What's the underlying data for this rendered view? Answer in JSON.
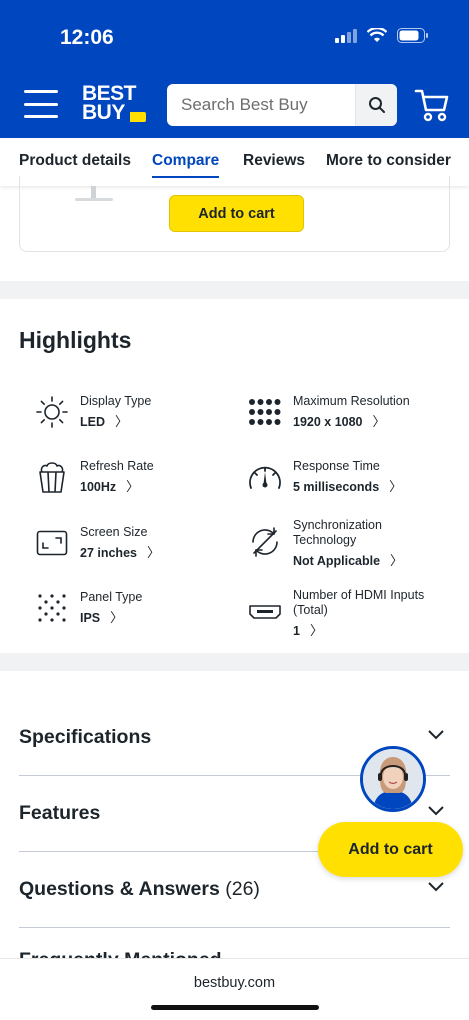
{
  "status_bar": {
    "time": "12:06"
  },
  "header": {
    "logo_line1": "BEST",
    "logo_line2": "BUY",
    "search_placeholder": "Search Best Buy"
  },
  "tabs": [
    {
      "label": "Product details"
    },
    {
      "label": "Compare"
    },
    {
      "label": "Reviews"
    },
    {
      "label": "More to consider"
    }
  ],
  "card": {
    "add_to_cart_label": "Add to cart"
  },
  "highlights": {
    "title": "Highlights",
    "items": [
      {
        "label": "Display Type",
        "value": "LED",
        "icon": "sun-icon"
      },
      {
        "label": "Maximum Resolution",
        "value": "1920 x 1080",
        "icon": "grid-dots-icon"
      },
      {
        "label": "Refresh Rate",
        "value": "100Hz",
        "icon": "popcorn-icon"
      },
      {
        "label": "Response Time",
        "value": "5 milliseconds",
        "icon": "gauge-icon"
      },
      {
        "label": "Screen Size",
        "value": "27 inches",
        "icon": "screen-size-icon"
      },
      {
        "label": "Synchronization Technology",
        "value": "Not Applicable",
        "icon": "sync-icon"
      },
      {
        "label": "Panel Type",
        "value": "IPS",
        "icon": "panel-dots-icon"
      },
      {
        "label": "Number of HDMI Inputs (Total)",
        "value": "1",
        "icon": "hdmi-icon"
      }
    ]
  },
  "accordion": [
    {
      "title": "Specifications",
      "count": ""
    },
    {
      "title": "Features",
      "count": ""
    },
    {
      "title": "Questions & Answers",
      "count": "(26)"
    }
  ],
  "partial_section_title": "Frequently Mentioned",
  "floating_add_to_cart": "Add to cart",
  "browser": {
    "url": "bestbuy.com"
  },
  "colors": {
    "brand_blue": "#0046be",
    "brand_yellow": "#ffe000"
  }
}
